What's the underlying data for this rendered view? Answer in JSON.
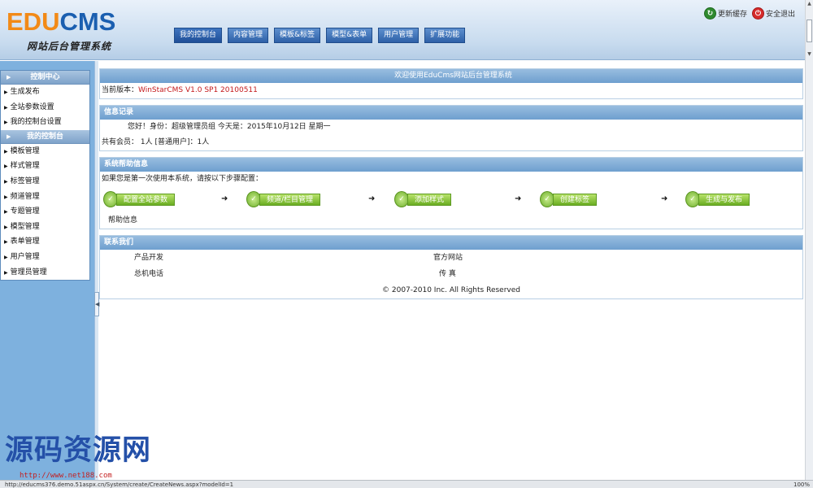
{
  "header": {
    "logo_edu": "EDU",
    "logo_cms": "CMS",
    "subtitle": "网站后台管理系统",
    "nav": [
      {
        "label": "我的控制台",
        "active": true
      },
      {
        "label": "内容管理"
      },
      {
        "label": "模板&标签"
      },
      {
        "label": "模型&表单"
      },
      {
        "label": "用户管理"
      },
      {
        "label": "扩展功能"
      }
    ],
    "refresh_label": "更新缓存",
    "logout_label": "安全退出"
  },
  "sidebar": {
    "section1": {
      "title": "控制中心",
      "items": [
        "生成发布",
        "全站参数设置",
        "我的控制台设置"
      ]
    },
    "section2": {
      "title": "我的控制台",
      "items": [
        "模板管理",
        "样式管理",
        "标签管理",
        "频道管理",
        "专题管理",
        "模型管理",
        "表单管理",
        "用户管理",
        "管理员管理"
      ]
    }
  },
  "main": {
    "welcome": {
      "title": "欢迎使用EduCms网站后台管理系统",
      "version_label": "当前版本：",
      "version_value": "WinStarCMS V1.0 SP1 20100511"
    },
    "info": {
      "title": "信息记录",
      "greeting": "您好！身份：超级管理员组 今天是：2015年10月12日 星期一",
      "members": "共有会员：  1人   [普通用户]：1人"
    },
    "help": {
      "title": "系统帮助信息",
      "intro": "如果您是第一次使用本系统，请按以下步骤配置：",
      "steps": [
        "配置全站参数",
        "频道/栏目管理",
        "添加样式",
        "创建标签",
        "生成与发布"
      ],
      "help_link": "帮助信息"
    },
    "contact": {
      "title": "联系我们",
      "product_dev": "产品开发",
      "official_site": "官方网站",
      "hotline": "总机电话",
      "fax": "传 真",
      "copyright": "© 2007-2010 Inc. All Rights Reserved"
    }
  },
  "watermark": {
    "title": "源码资源网",
    "url": "http://www.net188.com"
  },
  "statusbar": {
    "url": "http://educms376.demo.51aspx.cn/System/create/CreateNews.aspx?modelId=1",
    "zoom": "100%"
  },
  "colors": {
    "nav_blue": "#2e61a8",
    "panel_head": "#6e9fcf",
    "step_green": "#6aad22",
    "logo_orange": "#f28a17",
    "logo_blue": "#1b5fb0",
    "version_red": "#c4191b"
  },
  "icons": [
    "refresh-icon",
    "power-icon",
    "triangle-bullet-icon",
    "arrow-right-icon",
    "step-icon"
  ]
}
